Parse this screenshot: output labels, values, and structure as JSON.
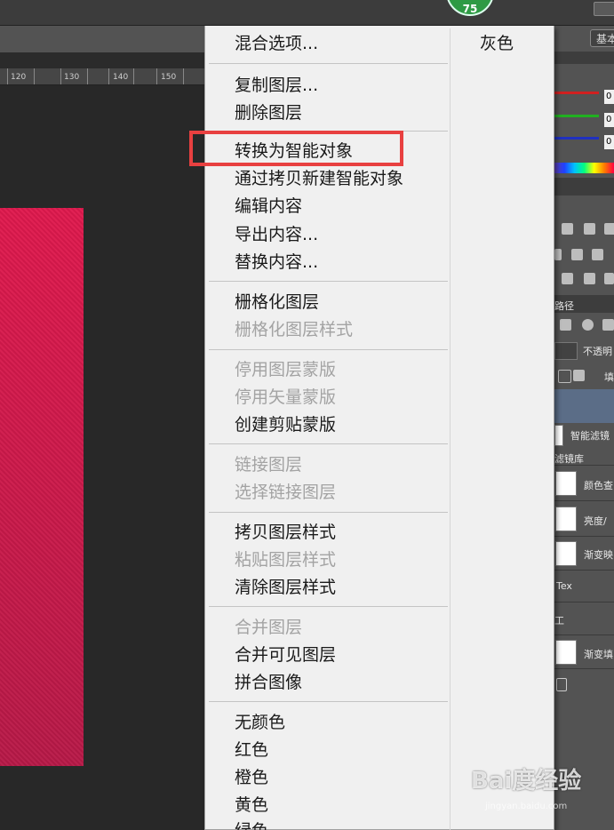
{
  "badge": {
    "value": "75"
  },
  "toolbar": {
    "workspace_label": "基本"
  },
  "ruler": {
    "ticks": [
      "120",
      "130",
      "140",
      "150"
    ]
  },
  "context_menu": {
    "items": [
      {
        "label": "混合选项...",
        "enabled": true
      },
      {
        "label": "复制图层...",
        "enabled": true
      },
      {
        "label": "删除图层",
        "enabled": true
      },
      {
        "label": "转换为智能对象",
        "enabled": true
      },
      {
        "label": "通过拷贝新建智能对象",
        "enabled": true
      },
      {
        "label": "编辑内容",
        "enabled": true
      },
      {
        "label": "导出内容...",
        "enabled": true
      },
      {
        "label": "替换内容...",
        "enabled": true
      },
      {
        "label": "栅格化图层",
        "enabled": true
      },
      {
        "label": "栅格化图层样式",
        "enabled": false
      },
      {
        "label": "停用图层蒙版",
        "enabled": false
      },
      {
        "label": "停用矢量蒙版",
        "enabled": false
      },
      {
        "label": "创建剪贴蒙版",
        "enabled": true
      },
      {
        "label": "链接图层",
        "enabled": false
      },
      {
        "label": "选择链接图层",
        "enabled": false
      },
      {
        "label": "拷贝图层样式",
        "enabled": true
      },
      {
        "label": "粘贴图层样式",
        "enabled": false
      },
      {
        "label": "清除图层样式",
        "enabled": true
      },
      {
        "label": "合并图层",
        "enabled": false
      },
      {
        "label": "合并可见图层",
        "enabled": true
      },
      {
        "label": "拼合图像",
        "enabled": true
      },
      {
        "label": "无颜色",
        "enabled": true
      },
      {
        "label": "红色",
        "enabled": true
      },
      {
        "label": "橙色",
        "enabled": true
      },
      {
        "label": "黄色",
        "enabled": true
      },
      {
        "label": "绿色",
        "enabled": true
      }
    ],
    "second_column": {
      "label": "灰色"
    },
    "highlighted_item": "转换为智能对象"
  },
  "right_panel": {
    "color_values": [
      "0",
      "0",
      "0"
    ],
    "paths_tab": "路径",
    "opacity_label": "不透明",
    "fill_label": "填",
    "layers": [
      {
        "label": "智能滤镜"
      },
      {
        "label": "滤镜库"
      },
      {
        "label": "颜色查"
      },
      {
        "label": "亮度/"
      },
      {
        "label": "渐变映"
      },
      {
        "label": "Tex"
      },
      {
        "label": "工"
      },
      {
        "label": "渐变填"
      }
    ]
  },
  "watermark": {
    "main": "Bai度经验",
    "sub": "jingyan.baidu.com"
  },
  "colors": {
    "highlight_border": "#e84040",
    "canvas_layer": "#d01a4c",
    "menu_bg": "#f0f0f0"
  }
}
